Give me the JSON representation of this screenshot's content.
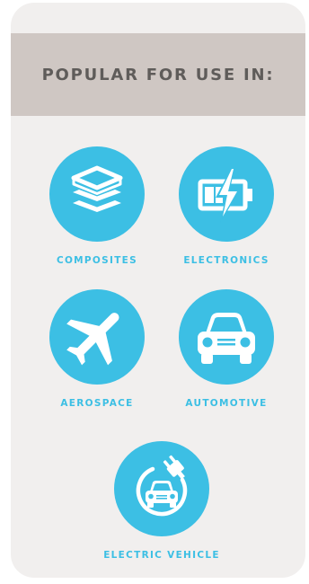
{
  "header": {
    "title": "POPULAR FOR USE IN:"
  },
  "uses": [
    {
      "label": "COMPOSITES",
      "icon": "layers-icon"
    },
    {
      "label": "ELECTRONICS",
      "icon": "battery-charging-icon"
    },
    {
      "label": "AEROSPACE",
      "icon": "airplane-icon"
    },
    {
      "label": "AUTOMOTIVE",
      "icon": "car-icon"
    },
    {
      "label": "ELECTRIC VEHICLE",
      "icon": "electric-car-plug-icon"
    }
  ],
  "colors": {
    "accent": "#3cbfe4",
    "banner": "#cfc7c3",
    "card": "#f1efee",
    "title": "#5f5c5a"
  }
}
